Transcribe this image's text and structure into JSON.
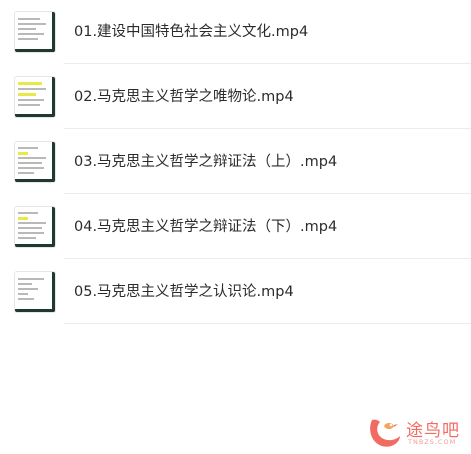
{
  "files": [
    {
      "name": "01.建设中国特色社会主义文化.mp4",
      "thumbnail": "video-thumbnail-icon"
    },
    {
      "name": "02.马克思主义哲学之唯物论.mp4",
      "thumbnail": "video-thumbnail-icon"
    },
    {
      "name": "03.马克思主义哲学之辩证法（上）.mp4",
      "thumbnail": "video-thumbnail-icon"
    },
    {
      "name": "04.马克思主义哲学之辩证法（下）.mp4",
      "thumbnail": "video-thumbnail-icon"
    },
    {
      "name": "05.马克思主义哲学之认识论.mp4",
      "thumbnail": "video-thumbnail-icon"
    }
  ],
  "watermark": {
    "text": "途鸟吧",
    "subtext": "TNBZS.COM",
    "color": "#f26b63"
  }
}
